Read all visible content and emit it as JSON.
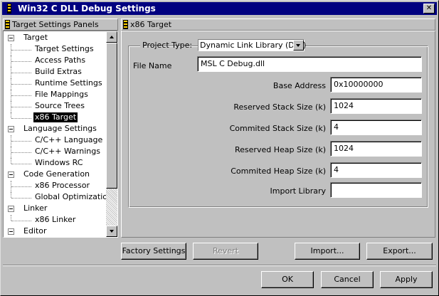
{
  "window": {
    "title": "Win32 C DLL Debug Settings",
    "close_icon": "close-icon",
    "app_icon": "settings-pin-icon"
  },
  "left_panel": {
    "header": "Target Settings Panels",
    "tree": [
      {
        "label": "Target",
        "level": 0,
        "expander": true
      },
      {
        "label": "Target Settings",
        "level": 1
      },
      {
        "label": "Access Paths",
        "level": 1
      },
      {
        "label": "Build Extras",
        "level": 1
      },
      {
        "label": "Runtime Settings",
        "level": 1
      },
      {
        "label": "File Mappings",
        "level": 1
      },
      {
        "label": "Source Trees",
        "level": 1
      },
      {
        "label": "x86 Target",
        "level": 1,
        "selected": true
      },
      {
        "label": "Language Settings",
        "level": 0,
        "expander": true
      },
      {
        "label": "C/C++ Language",
        "level": 1
      },
      {
        "label": "C/C++ Warnings",
        "level": 1
      },
      {
        "label": "Windows RC",
        "level": 1
      },
      {
        "label": "Code Generation",
        "level": 0,
        "expander": true
      },
      {
        "label": "x86 Processor",
        "level": 1
      },
      {
        "label": "Global Optimizations",
        "level": 1
      },
      {
        "label": "Linker",
        "level": 0,
        "expander": true
      },
      {
        "label": "x86 Linker",
        "level": 1
      },
      {
        "label": "Editor",
        "level": 0,
        "expander": true
      }
    ]
  },
  "right_panel": {
    "header": "x86 Target",
    "project_type_label": "Project Type:",
    "project_type_value": "Dynamic Link Library (DLL)",
    "file_name_label": "File Name",
    "file_name_value": "MSL C Debug.dll",
    "base_address_label": "Base Address",
    "base_address_value": "0x10000000",
    "reserved_stack_label": "Reserved Stack Size (k)",
    "reserved_stack_value": "1024",
    "commited_stack_label": "Commited Stack Size (k)",
    "commited_stack_value": "4",
    "reserved_heap_label": "Reserved Heap Size (k)",
    "reserved_heap_value": "1024",
    "commited_heap_label": "Commited Heap Size (k)",
    "commited_heap_value": "4",
    "import_library_label": "Import Library",
    "import_library_value": ""
  },
  "buttons": {
    "factory_settings": "Factory Settings",
    "revert": "Revert",
    "import": "Import...",
    "export": "Export...",
    "ok": "OK",
    "cancel": "Cancel",
    "apply": "Apply"
  }
}
